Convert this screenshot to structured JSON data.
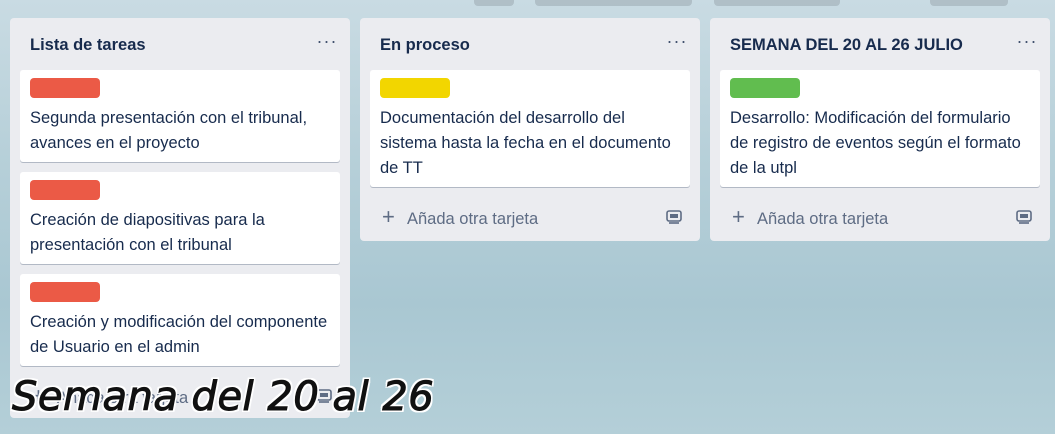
{
  "colors": {
    "label_red": "#eb5a46",
    "label_yellow": "#f2d600",
    "label_green": "#61bd4f"
  },
  "lists": [
    {
      "title": "Lista de tareas",
      "menu_icon": "ellipsis-icon",
      "cards": [
        {
          "label_color": "#eb5a46",
          "text": "Segunda presentación con el tribunal, avances en el proyecto"
        },
        {
          "label_color": "#eb5a46",
          "text": "Creación de diapositivas para la presentación con el tribunal"
        },
        {
          "label_color": "#eb5a46",
          "text": "Creación y modificación del componente de Usuario en el admin"
        }
      ],
      "add_card": "Añada otra tarjeta"
    },
    {
      "title": "En proceso",
      "menu_icon": "ellipsis-icon",
      "cards": [
        {
          "label_color": "#f2d600",
          "text": "Documentación del desarrollo del sistema hasta la fecha en el documento de TT"
        }
      ],
      "add_card": "Añada otra tarjeta"
    },
    {
      "title": "SEMANA DEL 20 AL 26 JULIO",
      "menu_icon": "ellipsis-icon",
      "cards": [
        {
          "label_color": "#61bd4f",
          "text": "Desarrollo: Modificación del formulario de registro de eventos según el formato de la utpl"
        }
      ],
      "add_card": "Añada otra tarjeta"
    }
  ],
  "caption": "Semana del 20 al 26"
}
